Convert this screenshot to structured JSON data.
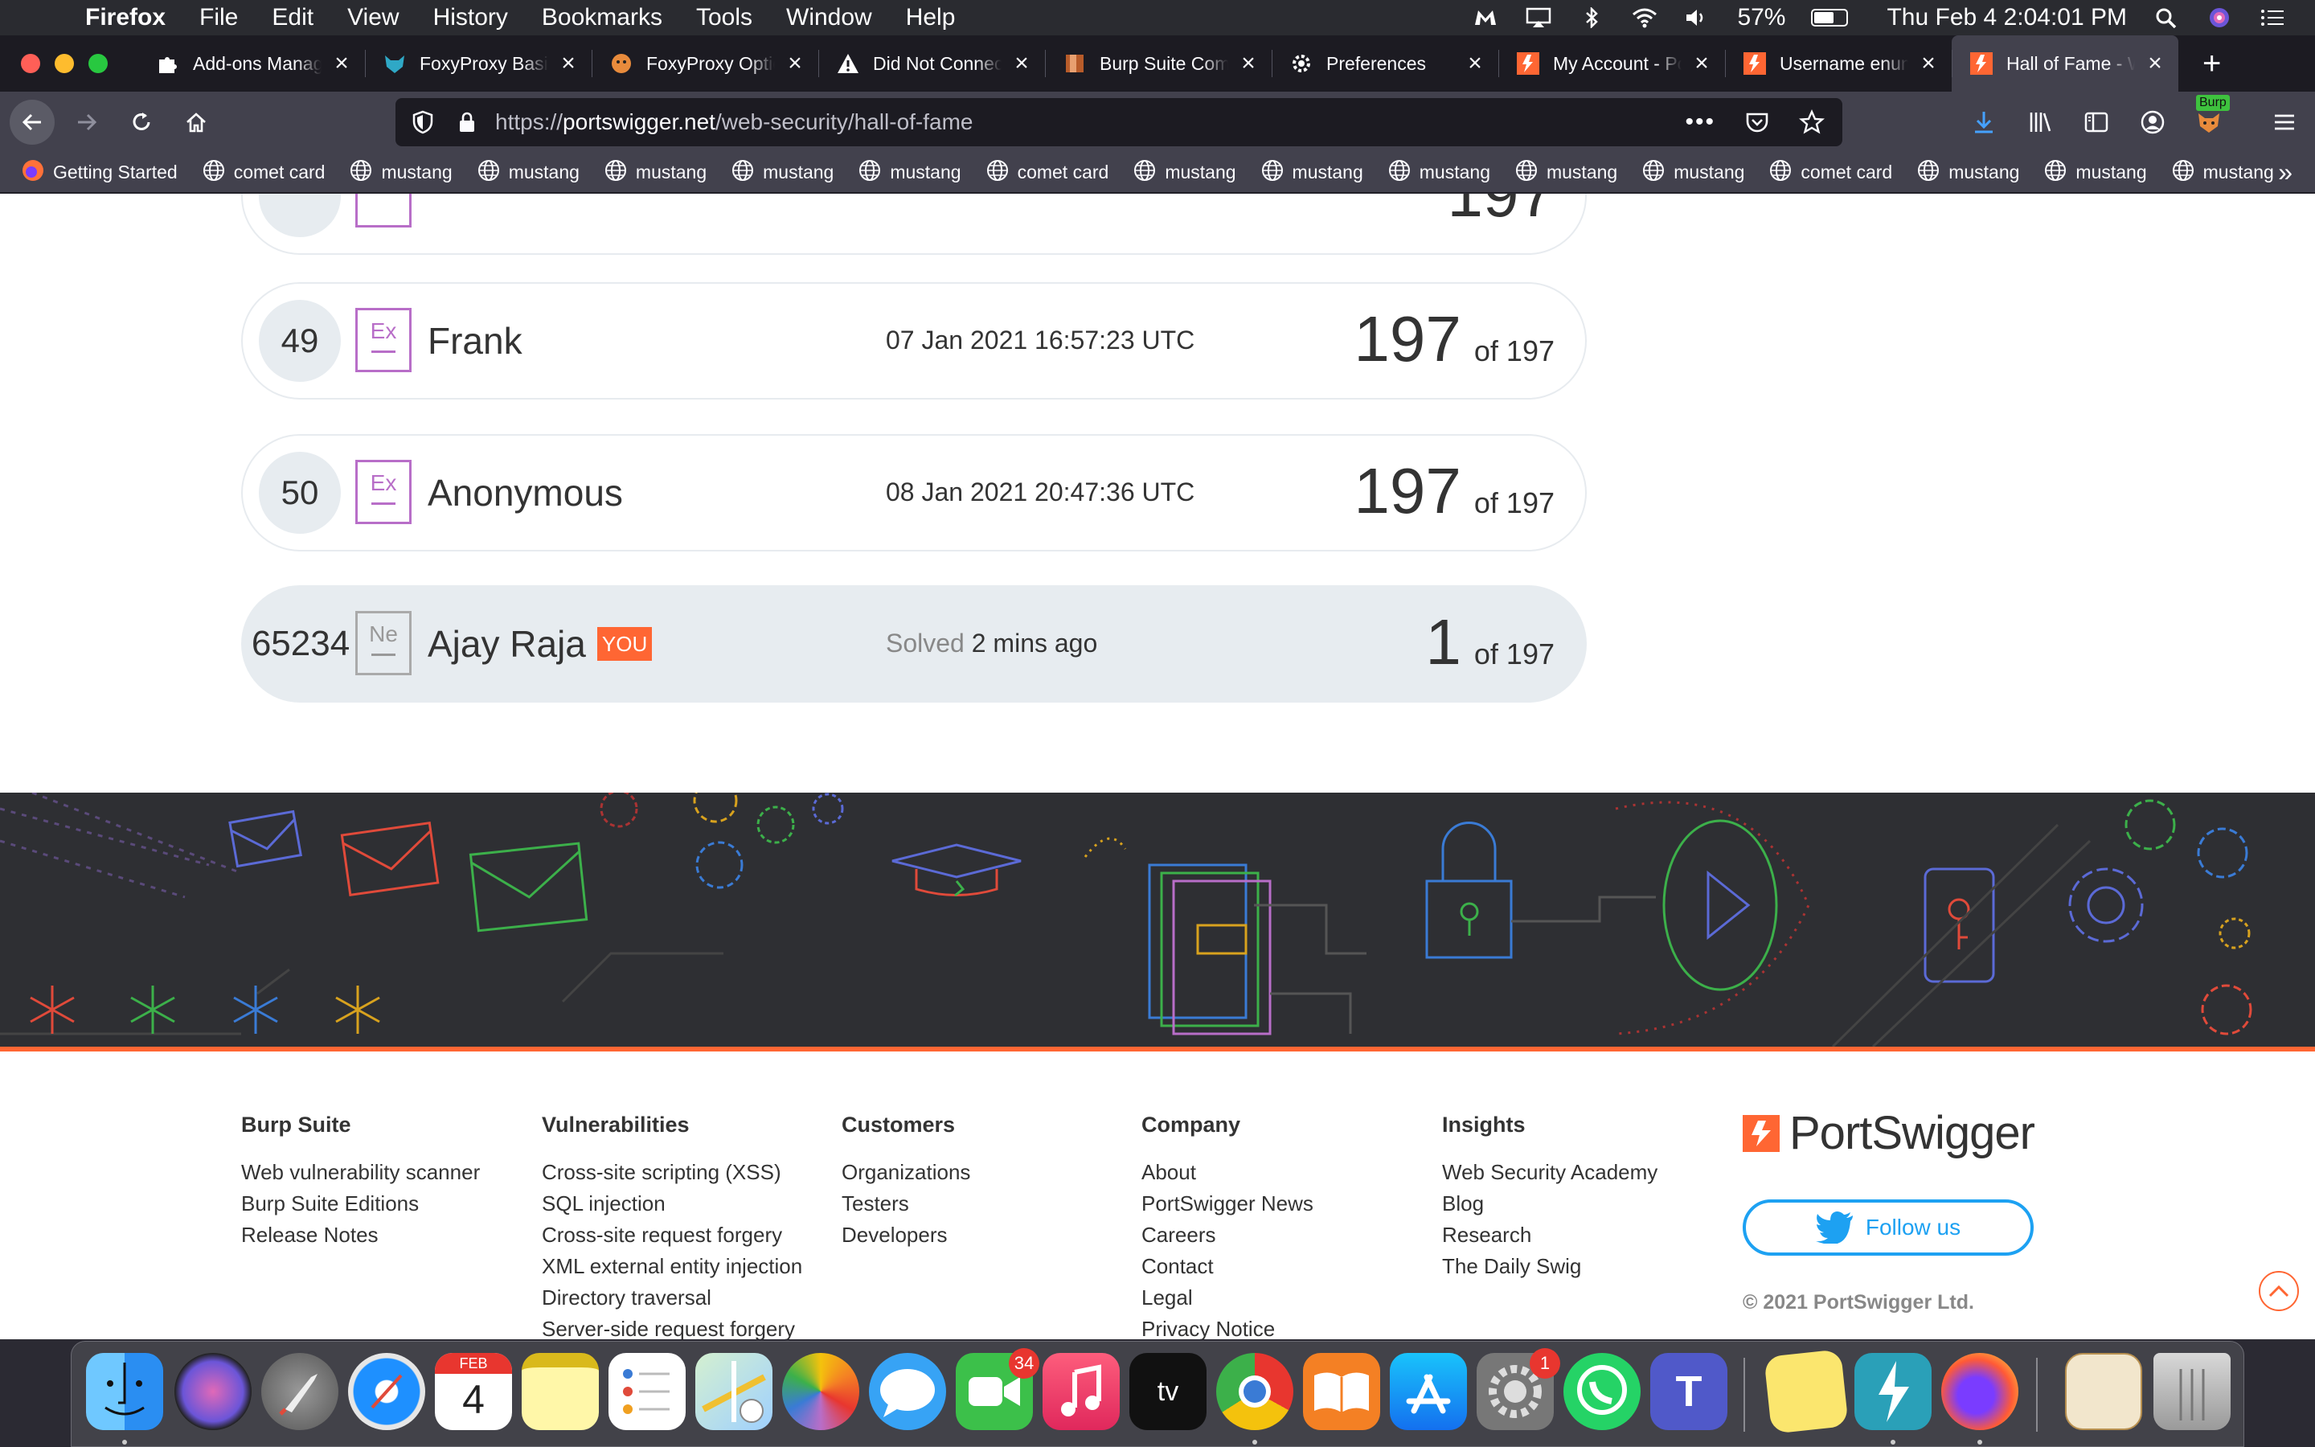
{
  "menubar": {
    "app": "Firefox",
    "menus": [
      "File",
      "Edit",
      "View",
      "History",
      "Bookmarks",
      "Tools",
      "Window",
      "Help"
    ],
    "battery": "57%",
    "clock": "Thu Feb 4  2:04:01 PM"
  },
  "tabs": [
    {
      "title": "Add-ons Manager",
      "icon": "puzzle-icon",
      "color": "#ffffff"
    },
    {
      "title": "FoxyProxy Basic",
      "icon": "foxyproxy-icon",
      "color": "#2fa8c6"
    },
    {
      "title": "FoxyProxy Options",
      "icon": "foxyproxy-orange-icon",
      "color": "#e88b3c"
    },
    {
      "title": "Did Not Connect",
      "icon": "warning-icon",
      "color": "#ffffff"
    },
    {
      "title": "Burp Suite Community",
      "icon": "burp-icon",
      "color": "#b85c2a"
    },
    {
      "title": "Preferences",
      "icon": "gear-icon",
      "color": "#ffffff"
    },
    {
      "title": "My Account - PortSwigger",
      "icon": "portswigger-icon",
      "color": "#ff6633"
    },
    {
      "title": "Username enumeration",
      "icon": "portswigger-icon",
      "color": "#ff6633"
    },
    {
      "title": "Hall of Fame - Web Security",
      "icon": "portswigger-icon",
      "color": "#ff6633",
      "active": true
    }
  ],
  "navbar": {
    "url_prefix": "https://",
    "url_domain": "portswigger.net",
    "url_path": "/web-security/hall-of-fame",
    "burp_label": "Burp"
  },
  "bookmarks": [
    {
      "label": "Getting Started",
      "icon": "firefox-icon"
    },
    {
      "label": "comet card",
      "icon": "globe-icon"
    },
    {
      "label": "mustang",
      "icon": "globe-icon"
    },
    {
      "label": "mustang",
      "icon": "globe-icon"
    },
    {
      "label": "mustang",
      "icon": "globe-icon"
    },
    {
      "label": "mustang",
      "icon": "globe-icon"
    },
    {
      "label": "mustang",
      "icon": "globe-icon"
    },
    {
      "label": "comet card",
      "icon": "globe-icon"
    },
    {
      "label": "mustang",
      "icon": "globe-icon"
    },
    {
      "label": "mustang",
      "icon": "globe-icon"
    },
    {
      "label": "mustang",
      "icon": "globe-icon"
    },
    {
      "label": "mustang",
      "icon": "globe-icon"
    },
    {
      "label": "mustang",
      "icon": "globe-icon"
    },
    {
      "label": "comet card",
      "icon": "globe-icon"
    },
    {
      "label": "mustang",
      "icon": "globe-icon"
    },
    {
      "label": "mustang",
      "icon": "globe-icon"
    },
    {
      "label": "mustang",
      "icon": "globe-icon"
    }
  ],
  "leaderboard": {
    "rows": [
      {
        "rank": "49",
        "badge": "Ex",
        "name": "Frank",
        "date": "07 Jan 2021 16:57:23 UTC",
        "solved": "197",
        "total": "of 197"
      },
      {
        "rank": "50",
        "badge": "Ex",
        "name": "Anonymous",
        "date": "08 Jan 2021 20:47:36 UTC",
        "solved": "197",
        "total": "of 197"
      }
    ],
    "you": {
      "rank": "65234",
      "badge": "Ne",
      "name": "Ajay Raja",
      "tag": "YOU",
      "solved_prefix": "Solved",
      "when": "2 mins ago",
      "solved": "1",
      "total": "of 197"
    }
  },
  "footer": {
    "columns": [
      {
        "heading": "Burp Suite",
        "links": [
          "Web vulnerability scanner",
          "Burp Suite Editions",
          "Release Notes"
        ]
      },
      {
        "heading": "Vulnerabilities",
        "links": [
          "Cross-site scripting (XSS)",
          "SQL injection",
          "Cross-site request forgery",
          "XML external entity injection",
          "Directory traversal",
          "Server-side request forgery"
        ]
      },
      {
        "heading": "Customers",
        "links": [
          "Organizations",
          "Testers",
          "Developers"
        ]
      },
      {
        "heading": "Company",
        "links": [
          "About",
          "PortSwigger News",
          "Careers",
          "Contact",
          "Legal",
          "Privacy Notice"
        ]
      },
      {
        "heading": "Insights",
        "links": [
          "Web Security Academy",
          "Blog",
          "Research",
          "The Daily Swig"
        ]
      }
    ],
    "brand": "PortSwigger",
    "follow": "Follow us",
    "copyright": "© 2021 PortSwigger Ltd."
  },
  "dock": {
    "calendar_month": "FEB",
    "calendar_day": "4",
    "facetime_badge": "34",
    "prefs_badge": "1"
  },
  "colors": {
    "accent": "#ff6633",
    "row_border": "#e7ebef",
    "you_row": "#e7ecf0",
    "badge_ex": "#b86ec8"
  }
}
